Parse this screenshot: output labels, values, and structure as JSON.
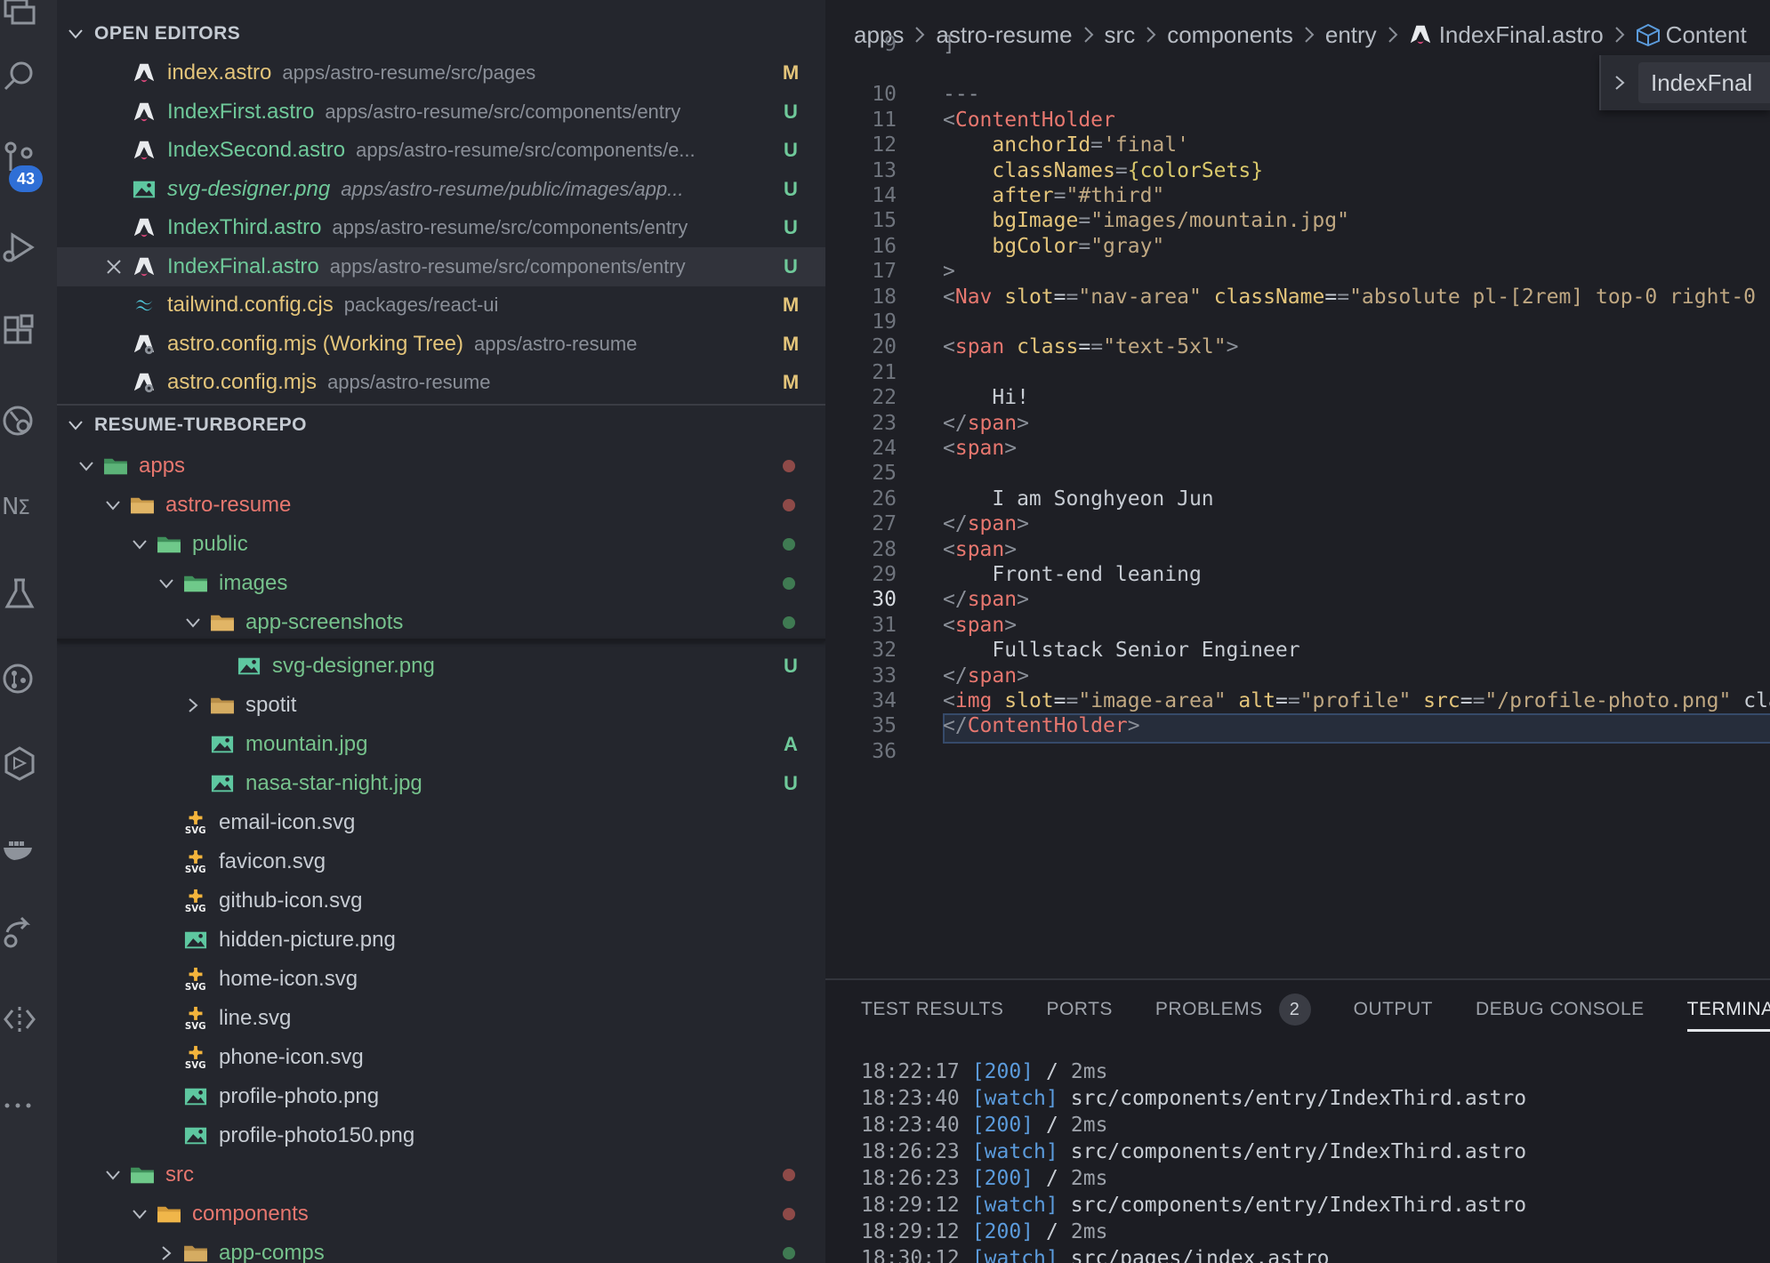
{
  "activity_bar": {
    "scm_badge": "43",
    "icons": [
      "explorer-icon",
      "search-icon",
      "source-control-icon",
      "run-debug-icon",
      "extensions-icon",
      "remote-explorer-icon",
      "nx-console-icon",
      "testing-icon",
      "git-graph-icon",
      "timeline-icon",
      "docker-icon",
      "live-share-icon",
      "code-diff-icon",
      "more-icon"
    ]
  },
  "open_editors": {
    "header": "OPEN EDITORS",
    "items": [
      {
        "name": "index.astro",
        "path": "apps/astro-resume/src/pages",
        "status": "M",
        "icon": "astro"
      },
      {
        "name": "IndexFirst.astro",
        "path": "apps/astro-resume/src/components/entry",
        "status": "U",
        "icon": "astro"
      },
      {
        "name": "IndexSecond.astro",
        "path": "apps/astro-resume/src/components/e...",
        "status": "U",
        "icon": "astro"
      },
      {
        "name": "svg-designer.png",
        "path": "apps/astro-resume/public/images/app...",
        "status": "U",
        "icon": "image"
      },
      {
        "name": "IndexThird.astro",
        "path": "apps/astro-resume/src/components/entry",
        "status": "U",
        "icon": "astro"
      },
      {
        "name": "IndexFinal.astro",
        "path": "apps/astro-resume/src/components/entry",
        "status": "U",
        "icon": "astro"
      },
      {
        "name": "tailwind.config.cjs",
        "path": "packages/react-ui",
        "status": "M",
        "icon": "tailwind"
      },
      {
        "name": "astro.config.mjs (Working Tree)",
        "path": "apps/astro-resume",
        "status": "M",
        "icon": "astro-config"
      },
      {
        "name": "astro.config.mjs",
        "path": "apps/astro-resume",
        "status": "M",
        "icon": "astro-config"
      }
    ]
  },
  "explorer": {
    "header": "RESUME-TURBOREPO",
    "tree": [
      {
        "name": "apps",
        "type": "folder",
        "status": "dot-red"
      },
      {
        "name": "astro-resume",
        "type": "folder",
        "status": "dot-red"
      },
      {
        "name": "public",
        "type": "folder",
        "status": "dot-green"
      },
      {
        "name": "images",
        "type": "folder",
        "status": "dot-green"
      },
      {
        "name": "app-screenshots",
        "type": "folder",
        "status": "dot-green"
      },
      {
        "name": "svg-designer.png",
        "type": "image",
        "status": "U"
      },
      {
        "name": "spotit",
        "type": "folder",
        "status": ""
      },
      {
        "name": "mountain.jpg",
        "type": "image",
        "status": "A"
      },
      {
        "name": "nasa-star-night.jpg",
        "type": "image",
        "status": "U"
      },
      {
        "name": "email-icon.svg",
        "type": "svg",
        "status": ""
      },
      {
        "name": "favicon.svg",
        "type": "svg",
        "status": ""
      },
      {
        "name": "github-icon.svg",
        "type": "svg",
        "status": ""
      },
      {
        "name": "hidden-picture.png",
        "type": "image",
        "status": ""
      },
      {
        "name": "home-icon.svg",
        "type": "svg",
        "status": ""
      },
      {
        "name": "line.svg",
        "type": "svg",
        "status": ""
      },
      {
        "name": "phone-icon.svg",
        "type": "svg",
        "status": ""
      },
      {
        "name": "profile-photo.png",
        "type": "image",
        "status": ""
      },
      {
        "name": "profile-photo150.png",
        "type": "image",
        "status": ""
      },
      {
        "name": "src",
        "type": "folder",
        "status": "dot-red"
      },
      {
        "name": "components",
        "type": "folder",
        "status": "dot-red"
      },
      {
        "name": "app-comps",
        "type": "folder",
        "status": "dot-green"
      }
    ],
    "svg_label": "SVG"
  },
  "breadcrumb": [
    "apps",
    "astro-resume",
    "src",
    "components",
    "entry",
    "IndexFinal.astro",
    "Content"
  ],
  "sticky_scroll": {
    "label": "IndexFnal"
  },
  "editor_lines": [
    {
      "n": "9",
      "code": "]"
    },
    {
      "n": "10",
      "code": "---"
    },
    {
      "n": "11",
      "code": "<ContentHolder"
    },
    {
      "n": "12",
      "code": "    anchorId='final'"
    },
    {
      "n": "13",
      "code": "    classNames={colorSets}"
    },
    {
      "n": "14",
      "code": "    after=\"#third\""
    },
    {
      "n": "15",
      "code": "    bgImage=\"images/mountain.jpg\""
    },
    {
      "n": "16",
      "code": "    bgColor=\"gray\""
    },
    {
      "n": "17",
      "code": ">"
    },
    {
      "n": "18",
      "code": "<Nav slot=\"nav-area\" className=\"absolute pl-[2rem] top-0 right-0"
    },
    {
      "n": "19",
      "code": ""
    },
    {
      "n": "20",
      "code": "<span class=\"text-5xl\">"
    },
    {
      "n": "21",
      "code": ""
    },
    {
      "n": "22",
      "code": "    Hi!"
    },
    {
      "n": "23",
      "code": "</span>"
    },
    {
      "n": "24",
      "code": "<span>"
    },
    {
      "n": "25",
      "code": ""
    },
    {
      "n": "26",
      "code": "    I am Songhyeon Jun"
    },
    {
      "n": "27",
      "code": "</span>"
    },
    {
      "n": "28",
      "code": "<span>"
    },
    {
      "n": "29",
      "code": "    Front-end leaning"
    },
    {
      "n": "30",
      "code": "</span>"
    },
    {
      "n": "31",
      "code": "<span>"
    },
    {
      "n": "32",
      "code": "    Fullstack Senior Engineer"
    },
    {
      "n": "33",
      "code": "</span>"
    },
    {
      "n": "34",
      "code": "<img slot=\"image-area\" alt=\"profile\" src=\"/profile-photo.png\" cla"
    },
    {
      "n": "35",
      "code": "</ContentHolder>"
    },
    {
      "n": "36",
      "code": ""
    }
  ],
  "current_line": "30",
  "panel": {
    "tabs": [
      {
        "label": "TEST RESULTS"
      },
      {
        "label": "PORTS"
      },
      {
        "label": "PROBLEMS",
        "badge": "2"
      },
      {
        "label": "OUTPUT"
      },
      {
        "label": "DEBUG CONSOLE"
      },
      {
        "label": "TERMINA"
      }
    ],
    "active_tab": "TERMINA",
    "terminal": [
      {
        "time": "18:22:17",
        "tag": "[200]",
        "msg": "/",
        "ms": "2ms"
      },
      {
        "time": "18:23:40",
        "tag": "[watch]",
        "msg": "src/components/entry/IndexThird.astro",
        "ms": ""
      },
      {
        "time": "18:23:40",
        "tag": "[200]",
        "msg": "/",
        "ms": "2ms"
      },
      {
        "time": "18:26:23",
        "tag": "[watch]",
        "msg": "src/components/entry/IndexThird.astro",
        "ms": ""
      },
      {
        "time": "18:26:23",
        "tag": "[200]",
        "msg": "/",
        "ms": "2ms"
      },
      {
        "time": "18:29:12",
        "tag": "[watch]",
        "msg": "src/components/entry/IndexThird.astro",
        "ms": ""
      },
      {
        "time": "18:29:12",
        "tag": "[200]",
        "msg": "/",
        "ms": "2ms"
      },
      {
        "time": "18:30:12",
        "tag": "[watch]",
        "msg": "src/pages/index.astro",
        "ms": ""
      }
    ]
  },
  "colors": {
    "modified": "#e3c47a",
    "untracked": "#6fc99a",
    "folder_red": "#e7776f",
    "folder_green": "#76c28c",
    "accent_blue": "#2f6fd6"
  }
}
